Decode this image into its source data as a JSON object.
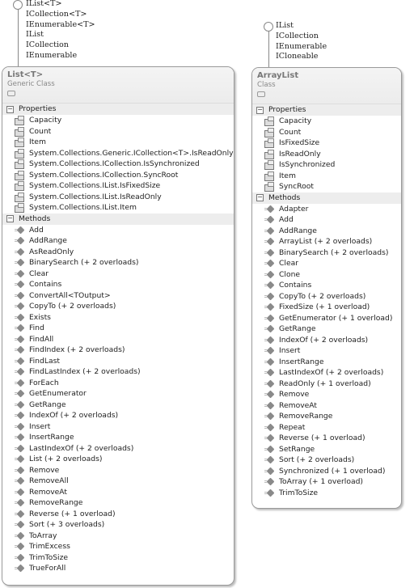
{
  "left": {
    "interfaces": [
      "IList<T>",
      "ICollection<T>",
      "IEnumerable<T>",
      "IList",
      "ICollection",
      "IEnumerable"
    ],
    "title": "List<T>",
    "kind": "Generic Class",
    "properties_label": "Properties",
    "methods_label": "Methods",
    "properties": [
      "Capacity",
      "Count",
      "Item",
      "System.Collections.Generic.ICollection<T>.IsReadOnly",
      "System.Collections.ICollection.IsSynchronized",
      "System.Collections.ICollection.SyncRoot",
      "System.Collections.IList.IsFixedSize",
      "System.Collections.IList.IsReadOnly",
      "System.Collections.IList.Item"
    ],
    "methods": [
      "Add",
      "AddRange",
      "AsReadOnly",
      "BinarySearch (+ 2 overloads)",
      "Clear",
      "Contains",
      "ConvertAll<TOutput>",
      "CopyTo (+ 2 overloads)",
      "Exists",
      "Find",
      "FindAll",
      "FindIndex (+ 2 overloads)",
      "FindLast",
      "FindLastIndex (+ 2 overloads)",
      "ForEach",
      "GetEnumerator",
      "GetRange",
      "IndexOf (+ 2 overloads)",
      "Insert",
      "InsertRange",
      "LastIndexOf (+ 2 overloads)",
      "List (+ 2 overloads)",
      "Remove",
      "RemoveAll",
      "RemoveAt",
      "RemoveRange",
      "Reverse (+ 1 overload)",
      "Sort (+ 3 overloads)",
      "ToArray",
      "TrimExcess",
      "TrimToSize",
      "TrueForAll"
    ]
  },
  "right": {
    "interfaces": [
      "IList",
      "ICollection",
      "IEnumerable",
      "ICloneable"
    ],
    "title": "ArrayList",
    "kind": "Class",
    "properties_label": "Properties",
    "methods_label": "Methods",
    "properties": [
      "Capacity",
      "Count",
      "IsFixedSize",
      "IsReadOnly",
      "IsSynchronized",
      "Item",
      "SyncRoot"
    ],
    "methods": [
      "Adapter",
      "Add",
      "AddRange",
      "ArrayList (+ 2 overloads)",
      "BinarySearch (+ 2 overloads)",
      "Clear",
      "Clone",
      "Contains",
      "CopyTo (+ 2 overloads)",
      "FixedSize (+ 1 overload)",
      "GetEnumerator (+ 1 overload)",
      "GetRange",
      "IndexOf (+ 2 overloads)",
      "Insert",
      "InsertRange",
      "LastIndexOf (+ 2 overloads)",
      "ReadOnly (+ 1 overload)",
      "Remove",
      "RemoveAt",
      "RemoveRange",
      "Repeat",
      "Reverse (+ 1 overload)",
      "SetRange",
      "Sort (+ 2 overloads)",
      "Synchronized (+ 1 overload)",
      "ToArray (+ 1 overload)",
      "TrimToSize"
    ]
  },
  "icons": {
    "collapse": "−"
  }
}
